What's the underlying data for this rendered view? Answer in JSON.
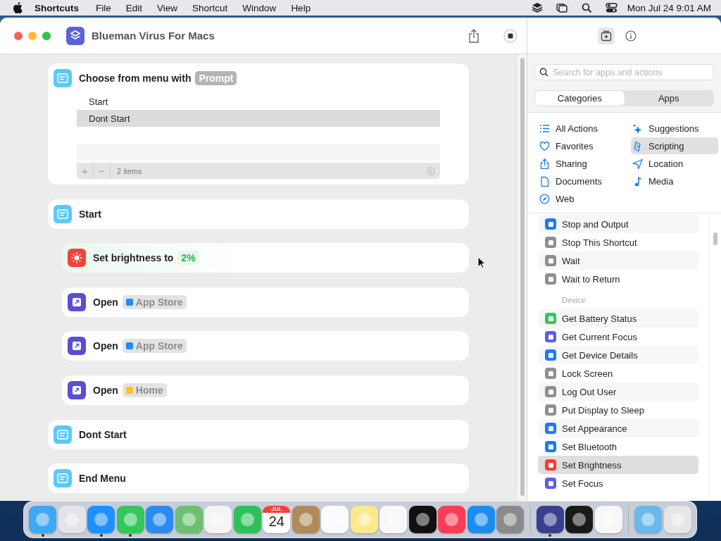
{
  "menubar": {
    "app": "Shortcuts",
    "menus": [
      "File",
      "Edit",
      "View",
      "Shortcut",
      "Window",
      "Help"
    ],
    "clock": "Mon Jul 24  9:01 AM"
  },
  "window": {
    "title": "Blueman Virus For Macs"
  },
  "editor": {
    "actions": [
      {
        "kind": "menu",
        "title": "Choose from menu with",
        "prompt": "Prompt",
        "items": [
          {
            "label": "Start",
            "selected": false
          },
          {
            "label": "Dont Start",
            "selected": true
          }
        ],
        "count": "2 items",
        "add": "+",
        "remove": "−"
      },
      {
        "kind": "case",
        "title": "Start",
        "children": [
          {
            "kind": "brightness",
            "title": "Set brightness to",
            "value": "2%"
          },
          {
            "kind": "open",
            "title": "Open",
            "app": {
              "label": "App Store",
              "color": "#1e8cf0"
            }
          },
          {
            "kind": "open",
            "title": "Open",
            "app": {
              "label": "App Store",
              "color": "#1e8cf0"
            }
          },
          {
            "kind": "open",
            "title": "Open",
            "app": {
              "label": "Home",
              "color": "#f2c230"
            }
          }
        ]
      },
      {
        "kind": "case",
        "title": "Dont Start"
      },
      {
        "kind": "end",
        "title": "End Menu"
      }
    ]
  },
  "library": {
    "search": {
      "placeholder": "Search for apps and actions"
    },
    "segments": [
      {
        "label": "Categories",
        "selected": true
      },
      {
        "label": "Apps",
        "selected": false
      }
    ],
    "categories": [
      {
        "label": "All Actions",
        "selected": false
      },
      {
        "label": "Suggestions",
        "selected": false
      },
      {
        "label": "Favorites",
        "selected": false
      },
      {
        "label": "Scripting",
        "selected": true
      },
      {
        "label": "Sharing",
        "selected": false
      },
      {
        "label": "Location",
        "selected": false
      },
      {
        "label": "Documents",
        "selected": false
      },
      {
        "label": "Media",
        "selected": false
      },
      {
        "label": "Web",
        "selected": false
      }
    ],
    "sections": [
      {
        "items": [
          {
            "label": "Stop and Output",
            "color": "#1d7cf2",
            "selected": false
          },
          {
            "label": "Stop This Shortcut",
            "color": "#8e8e93",
            "selected": false
          },
          {
            "label": "Wait",
            "color": "#8e8e93",
            "selected": false
          },
          {
            "label": "Wait to Return",
            "color": "#8e8e93",
            "selected": false
          }
        ]
      },
      {
        "title": "Device",
        "items": [
          {
            "label": "Get Battery Status",
            "color": "#34c759",
            "selected": false
          },
          {
            "label": "Get Current Focus",
            "color": "#5e5ce6",
            "selected": false
          },
          {
            "label": "Get Device Details",
            "color": "#1d7cf2",
            "selected": false
          },
          {
            "label": "Lock Screen",
            "color": "#8e8e93",
            "selected": false
          },
          {
            "label": "Log Out User",
            "color": "#8e8e93",
            "selected": false
          },
          {
            "label": "Put Display to Sleep",
            "color": "#8e8e93",
            "selected": false
          },
          {
            "label": "Set Appearance",
            "color": "#1d7cf2",
            "selected": false
          },
          {
            "label": "Set Bluetooth",
            "color": "#1d7cf2",
            "selected": false
          },
          {
            "label": "Set Brightness",
            "color": "#ff3b30",
            "selected": true
          },
          {
            "label": "Set Focus",
            "color": "#5e5ce6",
            "selected": false
          }
        ]
      }
    ]
  },
  "dock": {
    "groups": [
      [
        {
          "color": "#3ea8f5",
          "running": true
        },
        {
          "color": "#e4e4e8"
        },
        {
          "color": "#1e90ff",
          "running": true
        },
        {
          "color": "#34c759",
          "running": true
        },
        {
          "color": "#2a8cf0"
        },
        {
          "color": "#6cc070"
        },
        {
          "color": "#f4f4f4"
        },
        {
          "color": "#30c05a"
        },
        {
          "kind": "calendar",
          "color": "#ffffff",
          "month": "JUL",
          "day": "24"
        },
        {
          "color": "#b08a5a"
        },
        {
          "color": "#fafafa"
        },
        {
          "color": "#fbe98a"
        },
        {
          "color": "#f8f8f8"
        },
        {
          "color": "#111111"
        },
        {
          "color": "#fa3c55"
        },
        {
          "color": "#1b8cf2"
        },
        {
          "color": "#8a8a8a"
        }
      ],
      [
        {
          "color": "#3b3f8f",
          "running": true
        },
        {
          "color": "#1a1a1a"
        },
        {
          "color": "#f7f7f7"
        }
      ],
      [
        {
          "color": "#6ab8ec"
        },
        {
          "color": "#e6e6e6"
        }
      ]
    ]
  }
}
